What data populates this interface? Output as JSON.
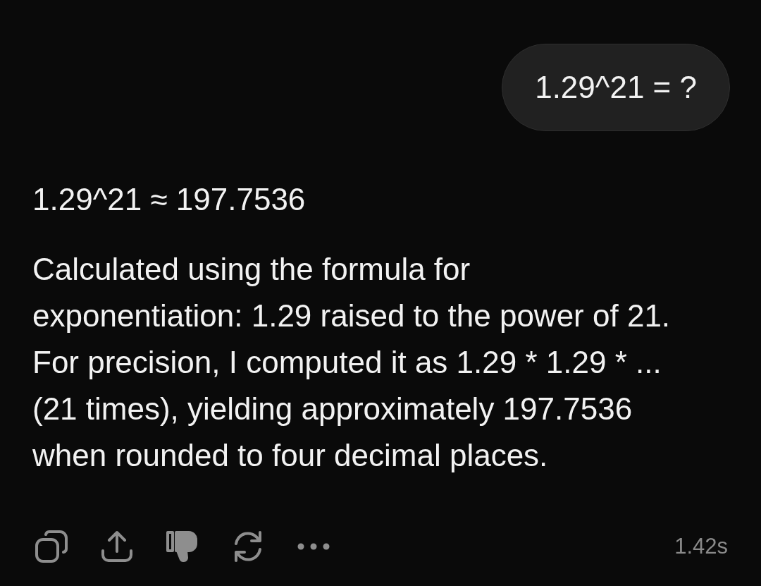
{
  "user_message": {
    "text": "1.29^21 = ?"
  },
  "response": {
    "heading": "1.29^21 ≈ 197.7536",
    "paragraph": "Calculated using the formula for exponentiation: 1.29 raised to the power of 21. For precision, I computed it as 1.29 * 1.29 * ... (21 times), yielding approximately 197.7536 when rounded to four decimal places.",
    "disliked": true,
    "duration": "1.42s"
  }
}
